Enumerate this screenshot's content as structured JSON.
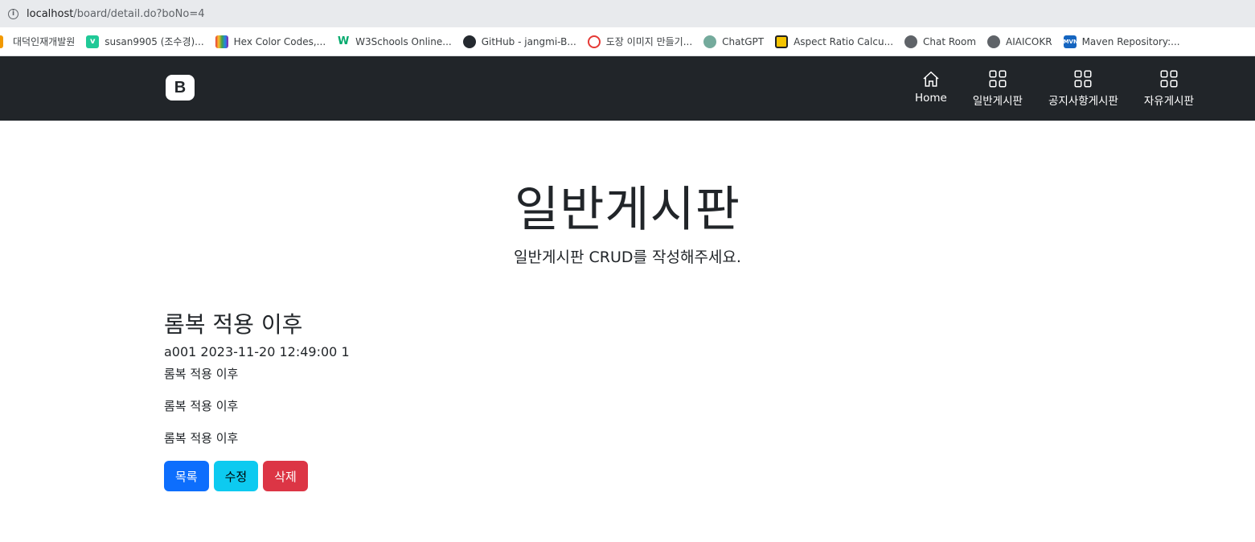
{
  "browser": {
    "url_host": "localhost",
    "url_path": "/board/detail.do?boNo=4",
    "bookmarks": [
      {
        "label": "대덕인재개발원",
        "icon": "pen-icon",
        "color": "#f29900"
      },
      {
        "label": "susan9905 (조수경)...",
        "icon": "velog-icon",
        "color": "#20c997"
      },
      {
        "label": "Hex Color Codes,...",
        "icon": "palette-icon",
        "color": "#7b61ff"
      },
      {
        "label": "W3Schools Online...",
        "icon": "w3schools-icon",
        "color": "#04aa6d"
      },
      {
        "label": "GitHub - jangmi-B...",
        "icon": "github-icon",
        "color": "#24292f"
      },
      {
        "label": "도장 이미지 만들기...",
        "icon": "stamp-icon",
        "color": "#e53935"
      },
      {
        "label": "ChatGPT",
        "icon": "chatgpt-icon",
        "color": "#74aa9c"
      },
      {
        "label": "Aspect Ratio Calcu...",
        "icon": "ratio-icon",
        "color": "#f5c400"
      },
      {
        "label": "Chat Room",
        "icon": "globe-icon",
        "color": "#5f6368"
      },
      {
        "label": "AIAICOKR",
        "icon": "globe-icon",
        "color": "#5f6368"
      },
      {
        "label": "Maven Repository:...",
        "icon": "maven-icon",
        "color": "#1565c0"
      }
    ]
  },
  "navbar": {
    "brand": "B",
    "items": [
      {
        "label": "Home",
        "icon": "home-icon"
      },
      {
        "label": "일반게시판",
        "icon": "grid-icon"
      },
      {
        "label": "공지사항게시판",
        "icon": "grid-icon"
      },
      {
        "label": "자유게시판",
        "icon": "grid-icon"
      }
    ]
  },
  "hero": {
    "title": "일반게시판",
    "subtitle": "일반게시판 CRUD를 작성해주세요."
  },
  "post": {
    "title": "롬복 적용 이후",
    "meta": "a001 2023-11-20 12:49:00 1",
    "lines": [
      "롬복 적용 이후",
      "롬복 적용 이후",
      "롬복 적용 이후"
    ]
  },
  "buttons": {
    "list": "목록",
    "edit": "수정",
    "delete": "삭제"
  }
}
